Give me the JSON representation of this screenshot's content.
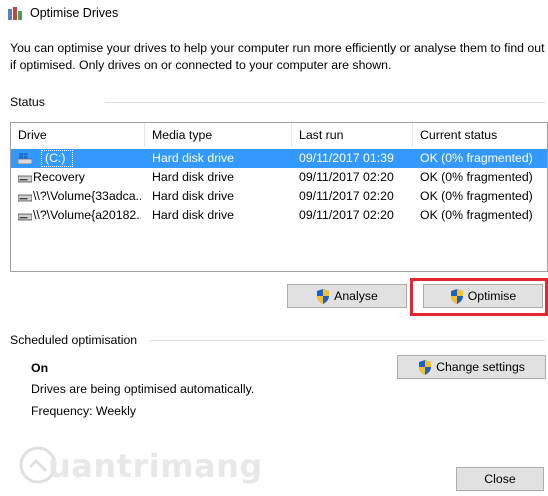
{
  "window": {
    "title": "Optimise Drives",
    "icon": "defrag-app-icon"
  },
  "intro_text": "You can optimise your drives to help your computer run more efficiently or analyse them to find out if optimised. Only drives on or connected to your computer are shown.",
  "status": {
    "label": "Status",
    "columns": [
      "Drive",
      "Media type",
      "Last run",
      "Current status"
    ],
    "rows": [
      {
        "drive": "(C:)",
        "media": "Hard disk drive",
        "last_run": "09/11/2017 01:39",
        "status": "OK (0% fragmented)",
        "icon": "windows-drive-icon",
        "selected": true
      },
      {
        "drive": "Recovery",
        "media": "Hard disk drive",
        "last_run": "09/11/2017 02:20",
        "status": "OK (0% fragmented)",
        "icon": "hard-drive-icon"
      },
      {
        "drive": "\\\\?\\Volume{33adca...",
        "media": "Hard disk drive",
        "last_run": "09/11/2017 02:20",
        "status": "OK (0% fragmented)",
        "icon": "hard-drive-icon"
      },
      {
        "drive": "\\\\?\\Volume{a20182...",
        "media": "Hard disk drive",
        "last_run": "09/11/2017 02:20",
        "status": "OK (0% fragmented)",
        "icon": "hard-drive-icon"
      }
    ],
    "analyse_label": "Analyse",
    "optimise_label": "Optimise"
  },
  "scheduled": {
    "label": "Scheduled optimisation",
    "state": "On",
    "description": "Drives are being optimised automatically.",
    "frequency": "Frequency: Weekly",
    "change_settings_label": "Change settings"
  },
  "close_label": "Close",
  "watermark_text": "uantrimang",
  "colors": {
    "selection": "#3399ff",
    "highlight_box": "#e3262f",
    "button_face": "#e1e1e1"
  }
}
